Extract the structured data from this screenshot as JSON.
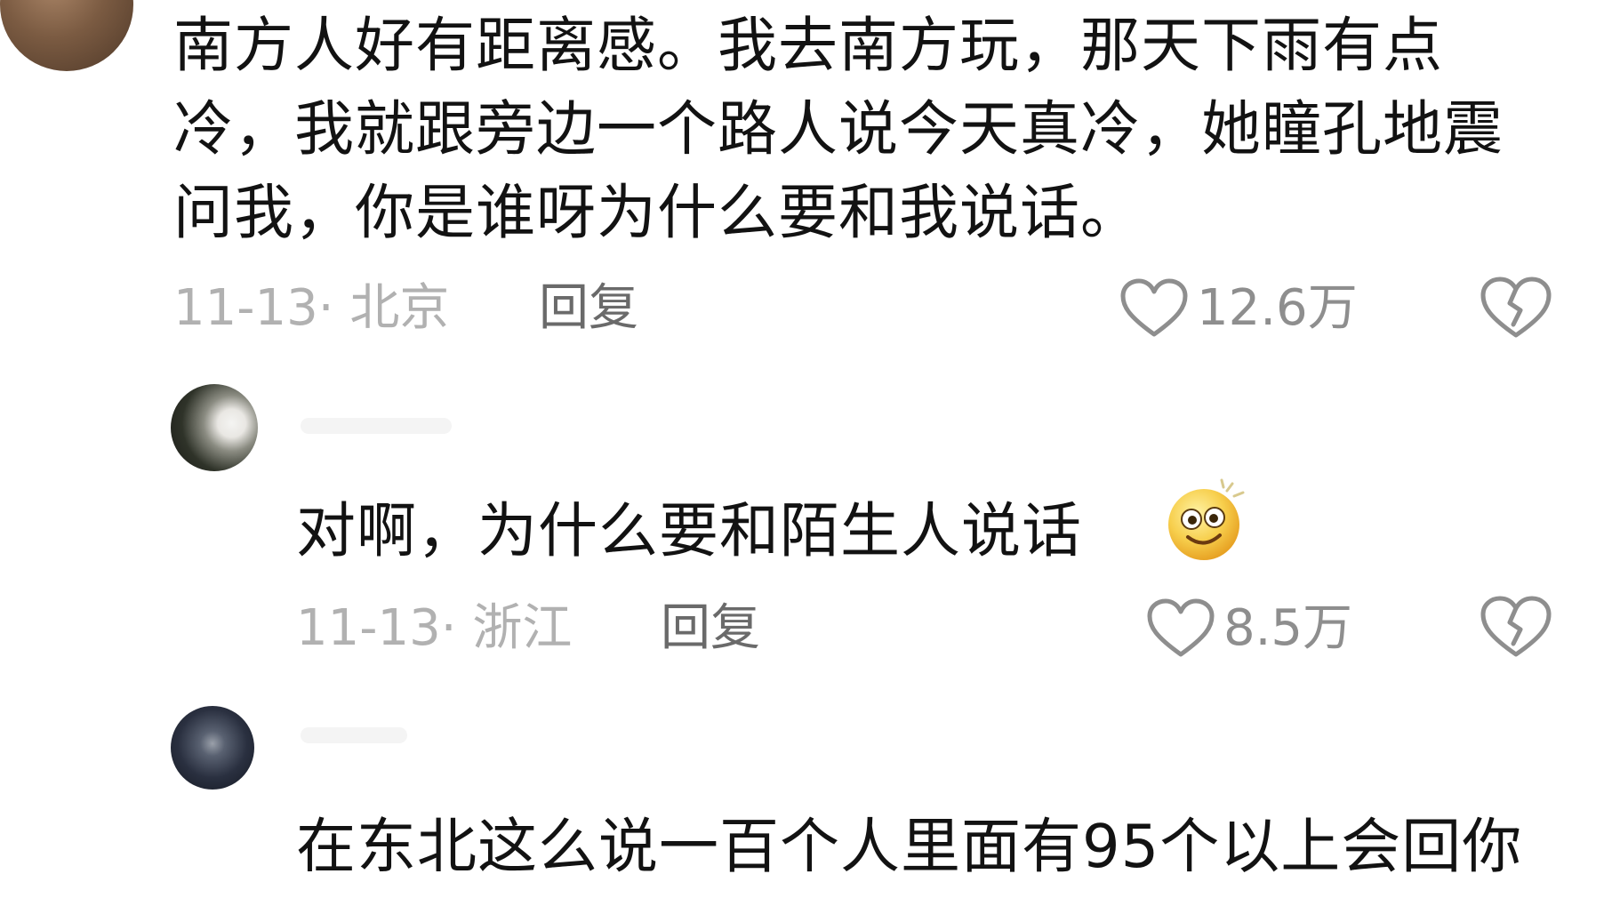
{
  "comments": [
    {
      "text": "南方人好有距离感。我去南方玩，那天下雨有点冷，我就跟旁边一个路人说今天真冷，她瞳孔地震问我，你是谁呀为什么要和我说话。",
      "date": "11-13",
      "location": "北京",
      "meta": "11-13· 北京",
      "reply_label": "回复",
      "like_count": "12.6万",
      "like_icon": "heart-outline-icon",
      "dislike_icon": "broken-heart-icon"
    },
    {
      "text": "对啊，为什么要和陌生人说话",
      "emoji": "dizzy-smile-emoji",
      "date": "11-13",
      "location": "浙江",
      "meta": "11-13· 浙江",
      "reply_label": "回复",
      "like_count": "8.5万",
      "like_icon": "heart-outline-icon",
      "dislike_icon": "broken-heart-icon"
    },
    {
      "text": "在东北这么说一百个人里面有95个以上会回你"
    }
  ],
  "colors": {
    "text": "#121212",
    "meta": "#b1b1b1",
    "reply": "#6a6a6a",
    "icon": "#8e8e8e",
    "background": "#ffffff"
  }
}
